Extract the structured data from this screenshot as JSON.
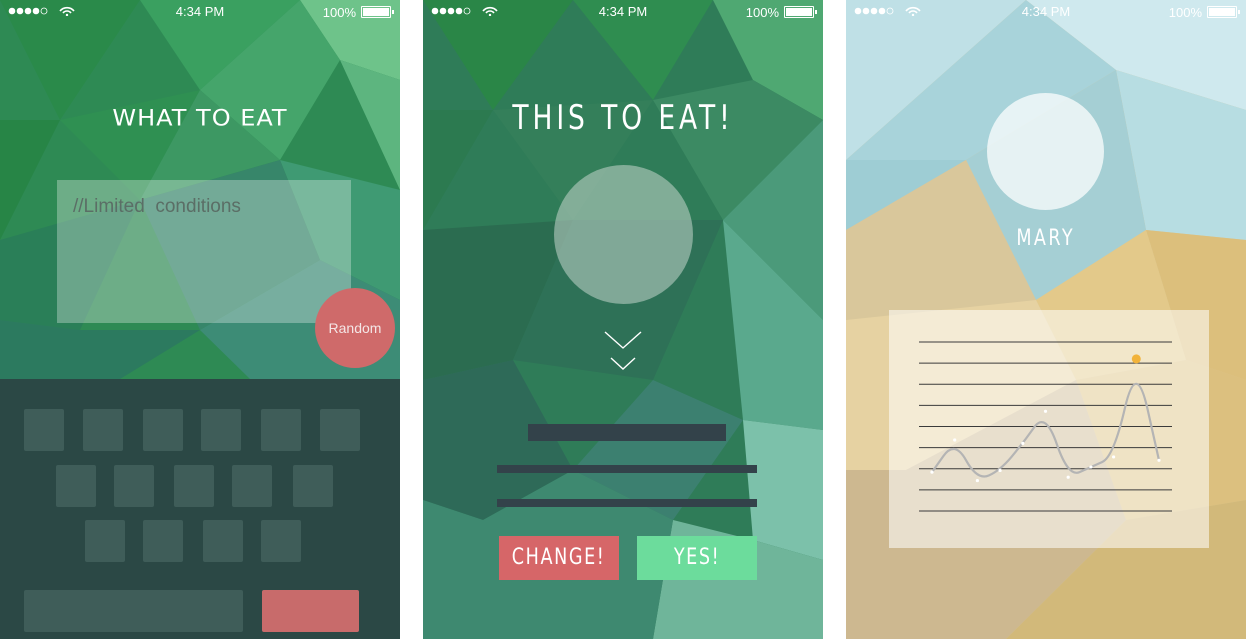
{
  "status_bar": {
    "time": "4:34 PM",
    "battery_percent": "100%",
    "signal_icon": "signal-dots-icon",
    "wifi_icon": "wifi-icon",
    "battery_icon": "battery-icon"
  },
  "screens": [
    {
      "title": "WHAT TO EAT",
      "conditions_text": "//Limited  conditions",
      "random_button_label": "Random",
      "keyboard": {
        "row_counts": [
          6,
          5,
          4
        ]
      },
      "colors": {
        "accent": "#cf6a6a",
        "keyboard_bg": "#2b4845",
        "background": "#2f8a55"
      }
    },
    {
      "title": "THIS TO EAT!",
      "change_button_label": "CHANGE!",
      "yes_button_label": "YES!",
      "down_icon": "double-chevron-down-icon",
      "colors": {
        "change": "#d66668",
        "yes": "#6cdc9c",
        "background": "#2f7c58"
      }
    },
    {
      "name": "MARY",
      "colors": {
        "highlight_point": "#f2b33a",
        "background": "#d8c79a"
      }
    }
  ],
  "chart_data": {
    "type": "line",
    "title": "",
    "xlabel": "",
    "ylabel": "",
    "grid": true,
    "gridlines": 9,
    "x": [
      0,
      1,
      2,
      3,
      4,
      5,
      6,
      7,
      8,
      9,
      10
    ],
    "values": [
      2.3,
      4.2,
      1.8,
      2.4,
      4.0,
      5.9,
      2.0,
      2.6,
      3.2,
      9.0,
      3.0
    ],
    "highlight_index": 9,
    "ylim": [
      0,
      10
    ]
  }
}
